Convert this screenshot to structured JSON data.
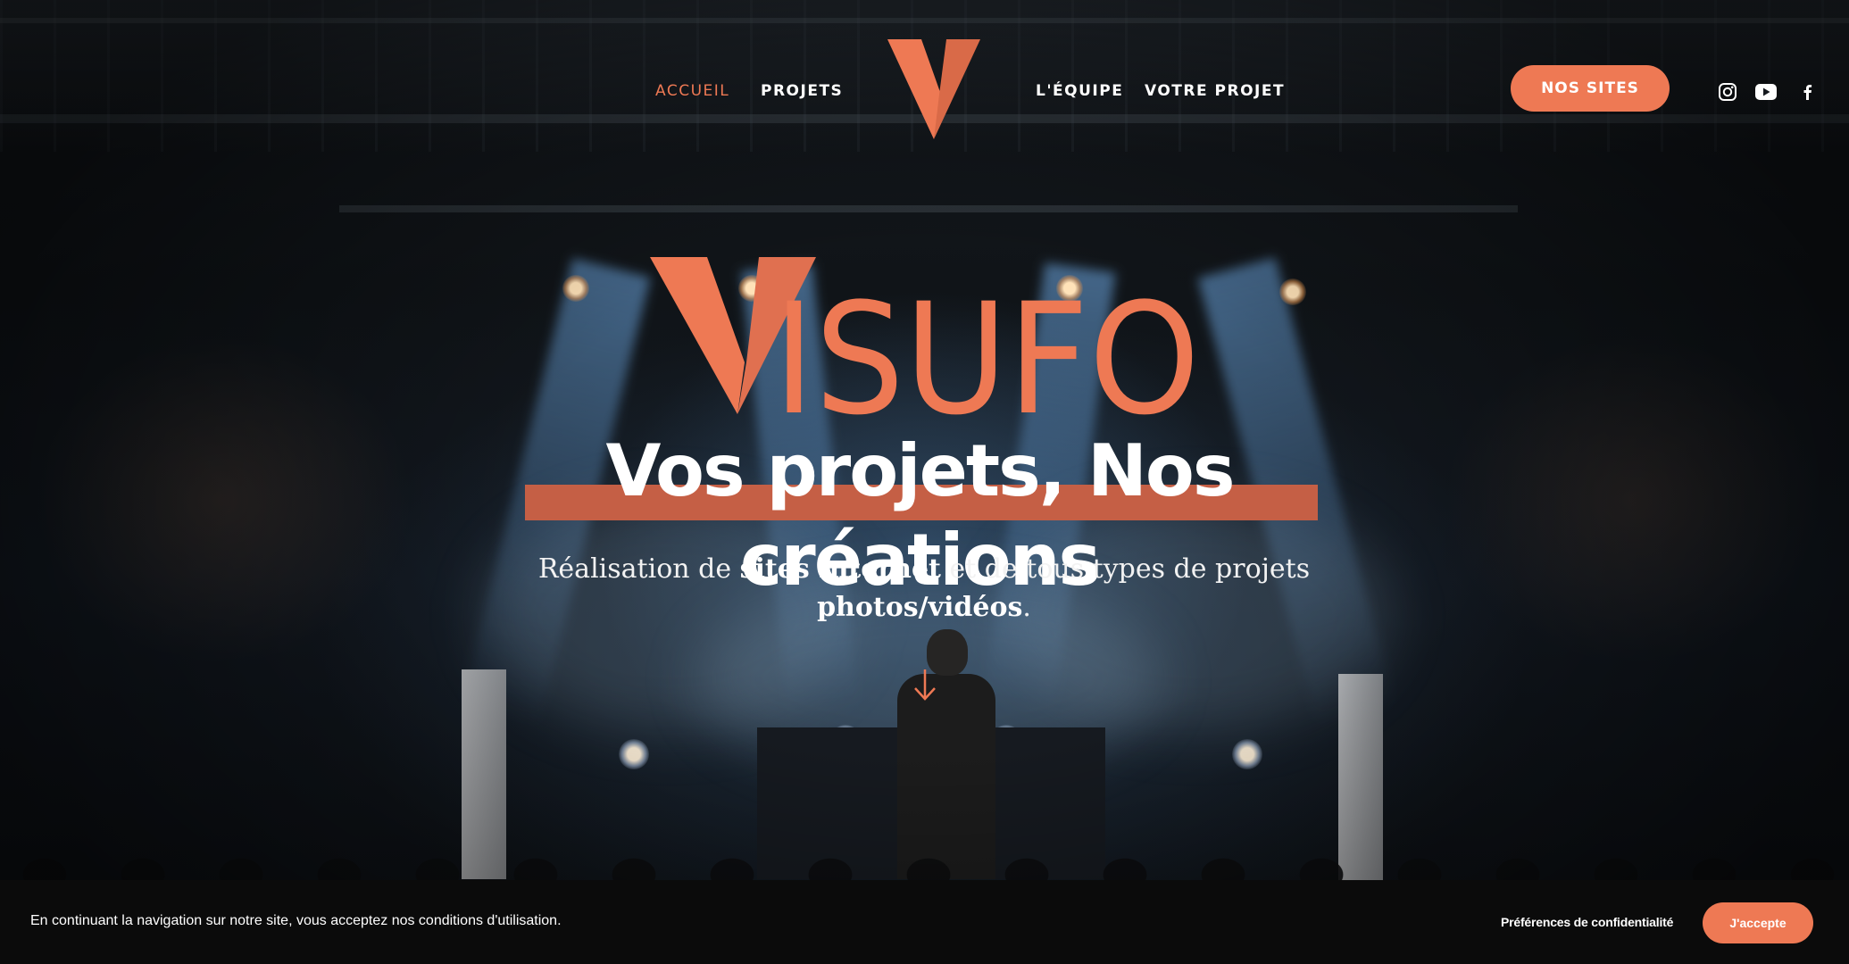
{
  "nav": {
    "items": [
      {
        "label": "ACCUEIL",
        "active": true
      },
      {
        "label": "PROJETS",
        "active": false
      },
      {
        "label": "L'ÉQUIPE",
        "active": false
      },
      {
        "label": "VOTRE PROJET",
        "active": false
      }
    ],
    "cta_label": "NOS SITES",
    "social_icons": [
      "instagram-icon",
      "youtube-icon",
      "facebook-icon"
    ]
  },
  "hero": {
    "brand_letters": "ISUFO",
    "tagline": "Vos projets, Nos créations",
    "subtitle": {
      "part1": "Réalisation de ",
      "bold1": "sites internet",
      "part2": " et de tous types de projets ",
      "bold2": "photos/vidéos",
      "part3": "."
    }
  },
  "cookie_banner": {
    "text": "En continuant la navigation sur notre site, vous acceptez nos conditions d'utilisation.",
    "preferences_label": "Préférences de confidentialité",
    "accept_label": "J'accepte"
  },
  "colors": {
    "accent": "#ee7954",
    "accent_dark": "#c55f45",
    "banner_bg": "#0b0b0b"
  }
}
